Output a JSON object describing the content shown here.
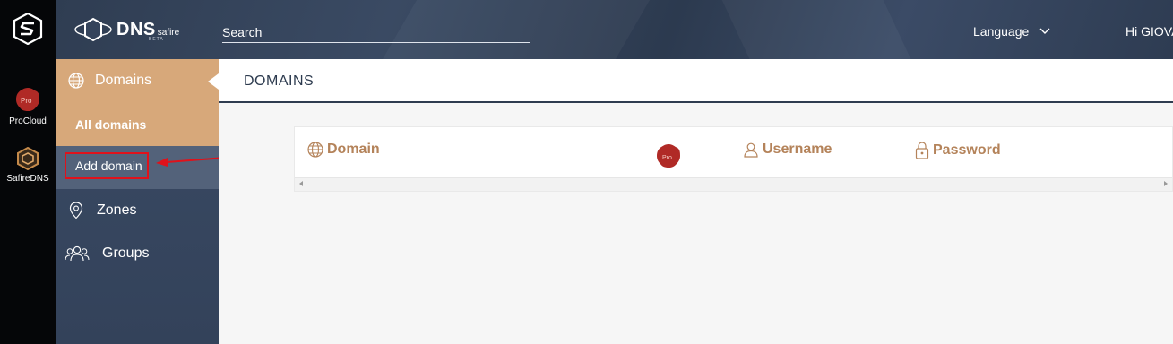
{
  "rail": {
    "apps": [
      {
        "label": "ProCloud",
        "icon": "procloud-icon"
      },
      {
        "label": "SafireDNS",
        "icon": "safiredns-icon"
      }
    ]
  },
  "header": {
    "brand_main": "DNS",
    "brand_sub": "safire",
    "brand_tag": "BETA",
    "search_placeholder": "Search",
    "language_label": "Language",
    "greeting": "Hi GIOVA"
  },
  "sidebar": {
    "domains_label": "Domains",
    "all_domains_label": "All domains",
    "add_domain_label": "Add domain",
    "zones_label": "Zones",
    "groups_label": "Groups"
  },
  "main": {
    "page_title": "DOMAINS",
    "columns": {
      "domain": "Domain",
      "pro_badge": "Pro",
      "username": "Username",
      "password": "Password"
    }
  },
  "colors": {
    "header_bg": "#34435b",
    "sidebar_bg": "#3a4a64",
    "sidebar_active": "#d7a87a",
    "column_header": "#b4835a",
    "annotation_red": "#e0121b"
  }
}
